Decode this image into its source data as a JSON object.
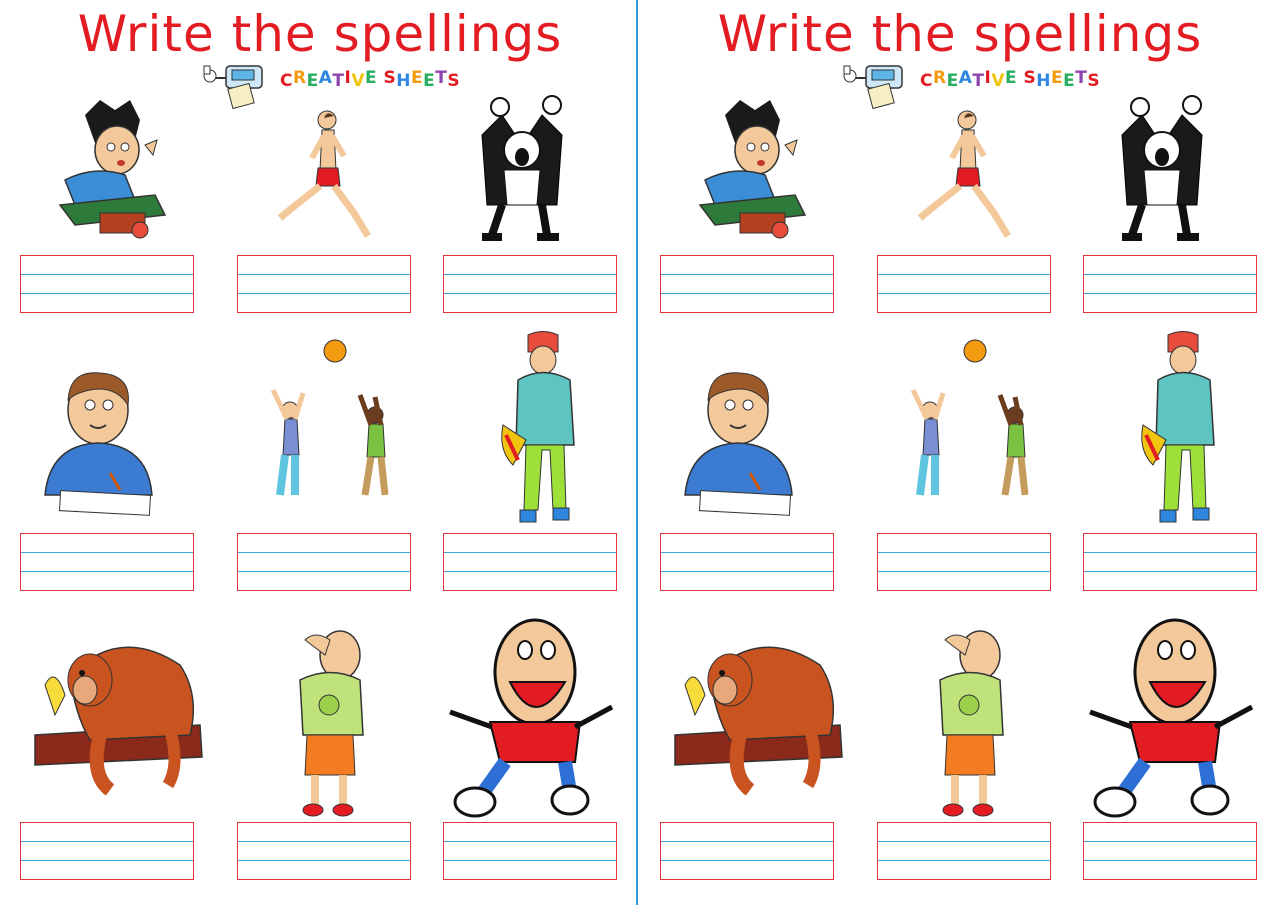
{
  "worksheet": {
    "title": "Write the spellings",
    "logo_text": "CREATIVE SHEETS",
    "logo_colors": [
      "#e31b23",
      "#f39c12",
      "#27ae60",
      "#2e86de",
      "#8e44ad",
      "#e31b23",
      "#f1c40f",
      "#27ae60",
      "#e31b23",
      "#2e86de",
      "#f39c12",
      "#27ae60",
      "#8e44ad",
      "#e31b23",
      "#2e86de"
    ],
    "pictures": [
      "boy-reading-icon",
      "running-man-icon",
      "shouting-man-icon",
      "boy-writing-icon",
      "children-playing-ball-icon",
      "walking-boy-icon",
      "monkey-eating-banana-icon",
      "boy-looking-up-icon",
      "laughing-boy-icon"
    ],
    "accent_red": "#e31b23",
    "line_blue": "#3ba7d8"
  }
}
